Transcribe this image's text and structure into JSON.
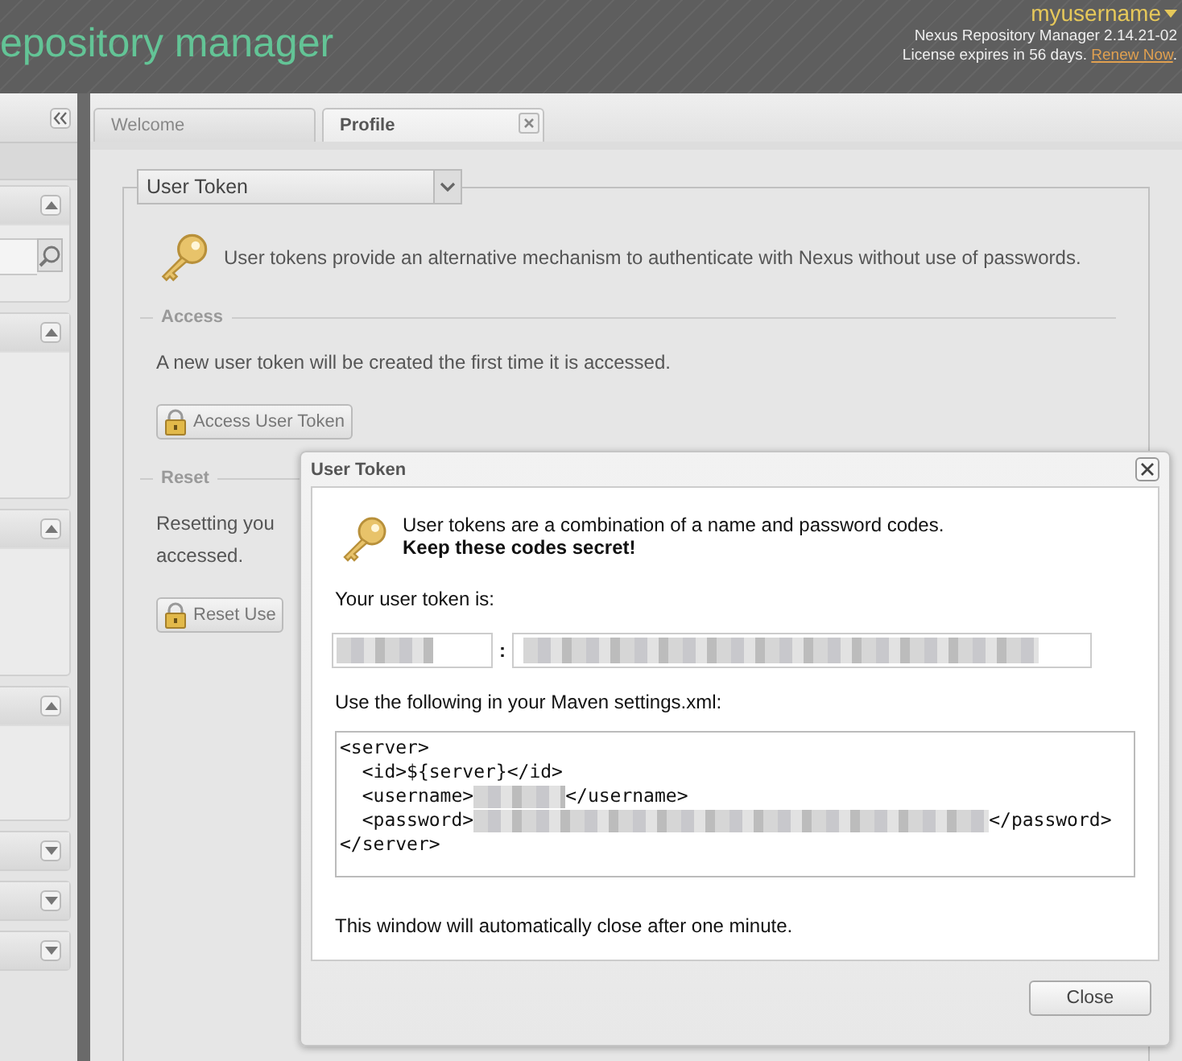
{
  "header": {
    "product_title": "epository manager",
    "user_menu": "myusername",
    "version": "Nexus Repository Manager 2.14.21-02",
    "license_text": "License expires in 56 days.",
    "license_link": "Renew Now",
    "license_end": "."
  },
  "sidebar": {
    "panels": [
      {
        "kind": "search",
        "expanded": true
      },
      {
        "kind": "list",
        "expanded": true
      },
      {
        "kind": "list",
        "expanded": true
      },
      {
        "kind": "list",
        "expanded": true
      },
      {
        "expanded": false
      },
      {
        "expanded": false
      },
      {
        "expanded": false
      }
    ]
  },
  "tabs": [
    {
      "label": "Welcome",
      "selected": false,
      "closable": false
    },
    {
      "label": "Profile",
      "selected": true,
      "closable": true
    }
  ],
  "profile": {
    "section_select": "User Token",
    "intro": "User tokens provide an alternative mechanism to authenticate with Nexus without use of passwords.",
    "sections": [
      {
        "legend": "Access",
        "lines": [
          "A new user token will be created the first time it is accessed."
        ],
        "button": "Access User Token"
      },
      {
        "legend": "Reset",
        "lines": [
          "Resetting you",
          "accessed."
        ],
        "button": "Reset Use"
      }
    ]
  },
  "dialog": {
    "title": "User Token",
    "message": "User tokens are a combination of a name and password codes.",
    "warning": "Keep these codes secret!",
    "token_label": "Your user token is:",
    "separator": ":",
    "settings_label": "Use the following in your Maven settings.xml:",
    "code_lines": [
      {
        "kind": "plain",
        "text": "<server>"
      },
      {
        "kind": "plain",
        "text": "  <id>${server}</id>"
      },
      {
        "kind": "redacted",
        "prefix": "  <username>",
        "suffix": "</username>"
      },
      {
        "kind": "redacted",
        "prefix": "  <password>",
        "suffix": "</password>"
      },
      {
        "kind": "plain",
        "text": "</server>"
      }
    ],
    "note": "This window will automatically close after one minute.",
    "close_button": "Close"
  }
}
